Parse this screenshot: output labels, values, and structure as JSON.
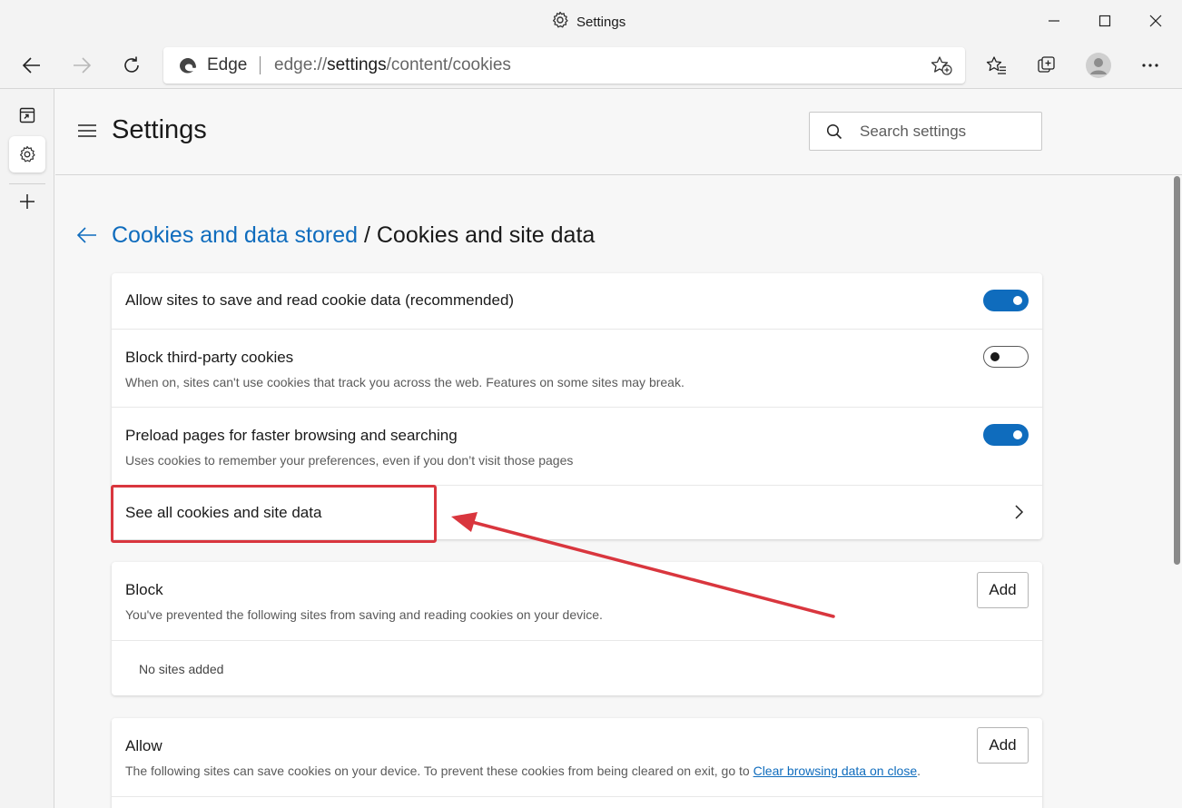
{
  "window": {
    "title": "Settings",
    "controls": [
      "minimize",
      "maximize",
      "close"
    ]
  },
  "toolbar": {
    "omnibox_label": "Edge",
    "url_prefix": "edge://",
    "url_host": "settings",
    "url_path": "/content/cookies",
    "icons": [
      "back-arrow-icon",
      "forward-arrow-icon",
      "refresh-icon",
      "add-favorite-icon",
      "favorites-icon",
      "collections-icon",
      "profile-avatar",
      "more-menu-icon"
    ]
  },
  "vertical_tabs": {
    "icons": [
      "tab-actions-icon",
      "settings-tab-icon",
      "new-tab-icon"
    ]
  },
  "header": {
    "title": "Settings",
    "search_placeholder": "Search settings"
  },
  "breadcrumb": {
    "parent": "Cookies and data stored",
    "separator": "/",
    "current": "Cookies and site data"
  },
  "cookies_card": {
    "rows": [
      {
        "title": "Allow sites to save and read cookie data (recommended)",
        "description": "",
        "toggle_on": true
      },
      {
        "title": "Block third-party cookies",
        "description": "When on, sites can't use cookies that track you across the web. Features on some sites may break.",
        "toggle_on": false
      },
      {
        "title": "Preload pages for faster browsing and searching",
        "description": "Uses cookies to remember your preferences, even if you don’t visit those pages",
        "toggle_on": true
      },
      {
        "title": "See all cookies and site data",
        "description": ""
      }
    ]
  },
  "block_card": {
    "title": "Block",
    "description": "You've prevented the following sites from saving and reading cookies on your device.",
    "add_label": "Add",
    "empty_text": "No sites added"
  },
  "allow_card": {
    "title": "Allow",
    "description": "The following sites can save cookies on your device. To prevent these cookies from being cleared on exit, go to",
    "link_text": "Clear browsing data on close",
    "link_suffix": ".",
    "add_label": "Add"
  },
  "colors": {
    "accent": "#0f6cbd",
    "annotation": "#d9363e",
    "background": "#f7f7f7"
  }
}
